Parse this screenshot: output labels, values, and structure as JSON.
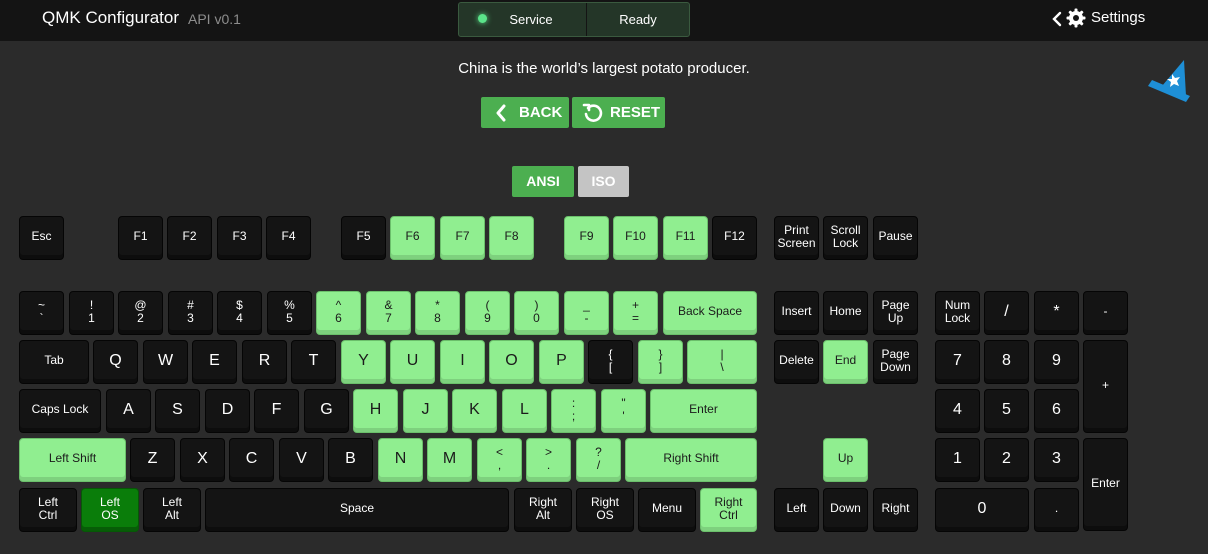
{
  "header": {
    "title": "QMK Configurator",
    "version": "API v0.1",
    "service_label": "Service",
    "status_label": "Ready",
    "settings_label": "Settings"
  },
  "message": "China is the world’s largest potato producer.",
  "buttons": {
    "back": "BACK",
    "reset": "RESET"
  },
  "layout_toggle": {
    "ansi": "ANSI",
    "iso": "ISO",
    "selected": "ANSI"
  },
  "colors": {
    "accent_green": "#4caf50",
    "tested_key": "#90ee90",
    "pressed_key": "#0a7d0a",
    "key_idle": "#141414",
    "iso_inactive": "#c4c4c4",
    "status_led": "#5be38a",
    "logo_blue": "#1e8fd6"
  },
  "icons": [
    "chevron-left-icon",
    "gear-icon",
    "back-arrow-icon",
    "reset-icon",
    "qmk-wizard-hat-logo-icon"
  ],
  "keyboard": {
    "legend": {
      "g": "tested key (light green)",
      "dg": "currently pressed key (dark green)"
    },
    "keys": [
      [
        "esc",
        "Esc",
        ""
      ],
      [
        "f1",
        "F1",
        ""
      ],
      [
        "f2",
        "F2",
        ""
      ],
      [
        "f3",
        "F3",
        ""
      ],
      [
        "f4",
        "F4",
        ""
      ],
      [
        "f5",
        "F5",
        ""
      ],
      [
        "f6",
        "F6",
        "g"
      ],
      [
        "f7",
        "F7",
        "g"
      ],
      [
        "f8",
        "F8",
        "g"
      ],
      [
        "f9",
        "F9",
        "g"
      ],
      [
        "f10",
        "F10",
        "g"
      ],
      [
        "f11",
        "F11",
        "g"
      ],
      [
        "f12",
        "F12",
        ""
      ],
      [
        "print-screen",
        "Print\nScreen",
        ""
      ],
      [
        "scroll-lock",
        "Scroll\nLock",
        ""
      ],
      [
        "pause",
        "Pause",
        ""
      ],
      [
        "grave",
        "~\n`",
        ""
      ],
      [
        "1",
        "!\n1",
        ""
      ],
      [
        "2",
        "@\n2",
        ""
      ],
      [
        "3",
        "#\n3",
        ""
      ],
      [
        "4",
        "$\n4",
        ""
      ],
      [
        "5",
        "%\n5",
        ""
      ],
      [
        "6",
        "^\n6",
        "g"
      ],
      [
        "7",
        "&\n7",
        "g"
      ],
      [
        "8",
        "*\n8",
        "g"
      ],
      [
        "9",
        "(\n9",
        "g"
      ],
      [
        "0",
        ")\n0",
        "g"
      ],
      [
        "minus",
        "_\n-",
        "g"
      ],
      [
        "equal",
        "+\n=",
        "g"
      ],
      [
        "backspace",
        "Back Space",
        "g"
      ],
      [
        "insert",
        "Insert",
        ""
      ],
      [
        "home",
        "Home",
        ""
      ],
      [
        "page-up",
        "Page\nUp",
        ""
      ],
      [
        "num-lock",
        "Num\nLock",
        ""
      ],
      [
        "kp-slash",
        "/",
        ""
      ],
      [
        "kp-asterisk",
        "*",
        ""
      ],
      [
        "kp-minus",
        "-",
        ""
      ],
      [
        "tab",
        "Tab",
        ""
      ],
      [
        "q",
        "Q",
        ""
      ],
      [
        "w",
        "W",
        ""
      ],
      [
        "e",
        "E",
        ""
      ],
      [
        "r",
        "R",
        ""
      ],
      [
        "t",
        "T",
        ""
      ],
      [
        "y",
        "Y",
        "g"
      ],
      [
        "u",
        "U",
        "g"
      ],
      [
        "i",
        "I",
        "g"
      ],
      [
        "o",
        "O",
        "g"
      ],
      [
        "p",
        "P",
        "g"
      ],
      [
        "lbracket",
        "{\n[",
        ""
      ],
      [
        "rbracket",
        "}\n]",
        "g"
      ],
      [
        "backslash",
        "|\n\\",
        "g"
      ],
      [
        "delete",
        "Delete",
        ""
      ],
      [
        "end",
        "End",
        "g"
      ],
      [
        "page-down",
        "Page\nDown",
        ""
      ],
      [
        "kp-7",
        "7",
        ""
      ],
      [
        "kp-8",
        "8",
        ""
      ],
      [
        "kp-9",
        "9",
        ""
      ],
      [
        "kp-plus",
        "+",
        ""
      ],
      [
        "caps-lock",
        "Caps Lock",
        ""
      ],
      [
        "a",
        "A",
        ""
      ],
      [
        "s",
        "S",
        ""
      ],
      [
        "d",
        "D",
        ""
      ],
      [
        "f",
        "F",
        ""
      ],
      [
        "g",
        "G",
        ""
      ],
      [
        "h",
        "H",
        "g"
      ],
      [
        "j",
        "J",
        "g"
      ],
      [
        "k",
        "K",
        "g"
      ],
      [
        "l",
        "L",
        "g"
      ],
      [
        "semicolon",
        ":\n;",
        "g"
      ],
      [
        "quote",
        "\"\n'",
        "g"
      ],
      [
        "enter",
        "Enter",
        "g"
      ],
      [
        "kp-4",
        "4",
        ""
      ],
      [
        "kp-5",
        "5",
        ""
      ],
      [
        "kp-6",
        "6",
        ""
      ],
      [
        "left-shift",
        "Left Shift",
        "g"
      ],
      [
        "z",
        "Z",
        ""
      ],
      [
        "x",
        "X",
        ""
      ],
      [
        "c",
        "C",
        ""
      ],
      [
        "v",
        "V",
        ""
      ],
      [
        "b",
        "B",
        ""
      ],
      [
        "n",
        "N",
        "g"
      ],
      [
        "m",
        "M",
        "g"
      ],
      [
        "comma",
        "<\n,",
        "g"
      ],
      [
        "period",
        ">\n.",
        "g"
      ],
      [
        "slash",
        "?\n/",
        "g"
      ],
      [
        "right-shift",
        "Right Shift",
        "g"
      ],
      [
        "up",
        "Up",
        "g"
      ],
      [
        "kp-1",
        "1",
        ""
      ],
      [
        "kp-2",
        "2",
        ""
      ],
      [
        "kp-3",
        "3",
        ""
      ],
      [
        "kp-enter",
        "Enter",
        ""
      ],
      [
        "left-ctrl",
        "Left\nCtrl",
        ""
      ],
      [
        "left-os",
        "Left\nOS",
        "dg"
      ],
      [
        "left-alt",
        "Left\nAlt",
        ""
      ],
      [
        "space",
        "Space",
        ""
      ],
      [
        "right-alt",
        "Right\nAlt",
        ""
      ],
      [
        "right-os",
        "Right\nOS",
        ""
      ],
      [
        "menu",
        "Menu",
        ""
      ],
      [
        "right-ctrl",
        "Right\nCtrl",
        "g"
      ],
      [
        "left",
        "Left",
        ""
      ],
      [
        "down",
        "Down",
        ""
      ],
      [
        "right",
        "Right",
        ""
      ],
      [
        "kp-0",
        "0",
        ""
      ],
      [
        "kp-dot",
        ".",
        ""
      ]
    ]
  }
}
